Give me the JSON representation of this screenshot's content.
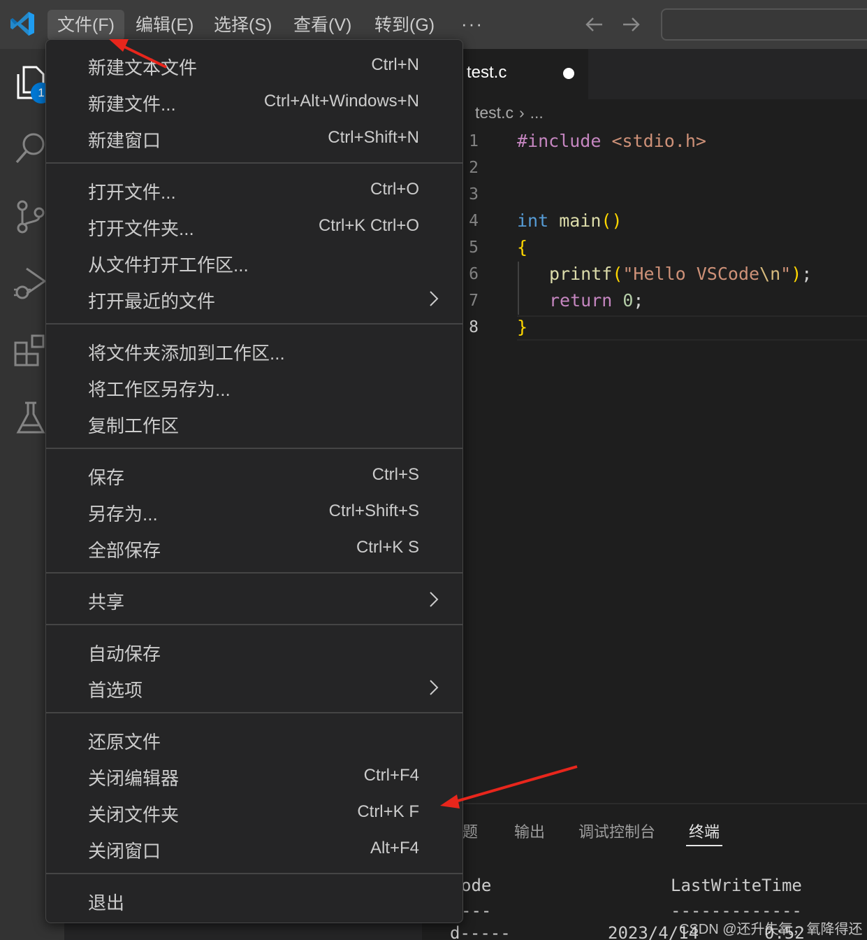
{
  "menubar": {
    "items": [
      "文件(F)",
      "编辑(E)",
      "选择(S)",
      "查看(V)",
      "转到(G)"
    ],
    "more": "···"
  },
  "activity": {
    "explorer_badge": "1"
  },
  "editor": {
    "tab_label": "test.c",
    "breadcrumb_file": "test.c",
    "breadcrumb_more": "...",
    "line_numbers": [
      "1",
      "2",
      "3",
      "4",
      "5",
      "6",
      "7",
      "8"
    ],
    "code": {
      "l1_pre": "#include",
      "l1_inc": " <stdio.h>",
      "l4_kw": "int",
      "l4_fn": " main",
      "l4_parens": "()",
      "l5_brace": "{",
      "l6_fn": "printf",
      "l6_paren_open": "(",
      "l6_str": "\"Hello VSCode",
      "l6_esc": "\\n",
      "l6_str_end": "\"",
      "l6_paren_close": ")",
      "l6_semi": ";",
      "l7_kw": "return",
      "l7_num": " 0",
      "l7_semi": ";",
      "l8_brace": "}"
    }
  },
  "file_menu": {
    "groups": [
      [
        {
          "label": "新建文本文件",
          "shortcut": "Ctrl+N"
        },
        {
          "label": "新建文件...",
          "shortcut": "Ctrl+Alt+Windows+N"
        },
        {
          "label": "新建窗口",
          "shortcut": "Ctrl+Shift+N"
        }
      ],
      [
        {
          "label": "打开文件...",
          "shortcut": "Ctrl+O"
        },
        {
          "label": "打开文件夹...",
          "shortcut": "Ctrl+K Ctrl+O"
        },
        {
          "label": "从文件打开工作区...",
          "shortcut": ""
        },
        {
          "label": "打开最近的文件",
          "shortcut": ""
        }
      ],
      [
        {
          "label": "将文件夹添加到工作区...",
          "shortcut": ""
        },
        {
          "label": "将工作区另存为...",
          "shortcut": ""
        },
        {
          "label": "复制工作区",
          "shortcut": ""
        }
      ],
      [
        {
          "label": "保存",
          "shortcut": "Ctrl+S"
        },
        {
          "label": "另存为...",
          "shortcut": "Ctrl+Shift+S"
        },
        {
          "label": "全部保存",
          "shortcut": "Ctrl+K S"
        }
      ],
      [
        {
          "label": "共享",
          "shortcut": ""
        }
      ],
      [
        {
          "label": "自动保存",
          "shortcut": ""
        },
        {
          "label": "首选项",
          "shortcut": ""
        }
      ],
      [
        {
          "label": "还原文件",
          "shortcut": ""
        },
        {
          "label": "关闭编辑器",
          "shortcut": "Ctrl+F4"
        },
        {
          "label": "关闭文件夹",
          "shortcut": "Ctrl+K F"
        },
        {
          "label": "关闭窗口",
          "shortcut": "Alt+F4"
        }
      ],
      [
        {
          "label": "退出",
          "shortcut": ""
        }
      ]
    ]
  },
  "panel": {
    "tabs": [
      "题",
      "输出",
      "调试控制台",
      "终端"
    ],
    "terminal": {
      "header_left": "ode",
      "header_right": "LastWriteTime",
      "dashes_left": "---",
      "dashes_right": "-------------",
      "row_mode": "d-----",
      "row_date": "2023/4/14",
      "row_time": "0:52"
    }
  },
  "watermark": "CSDN @还升失氧，氧降得还",
  "colors": {
    "accent_badge": "#0078d4",
    "annotation_arrow": "#e8261c"
  }
}
